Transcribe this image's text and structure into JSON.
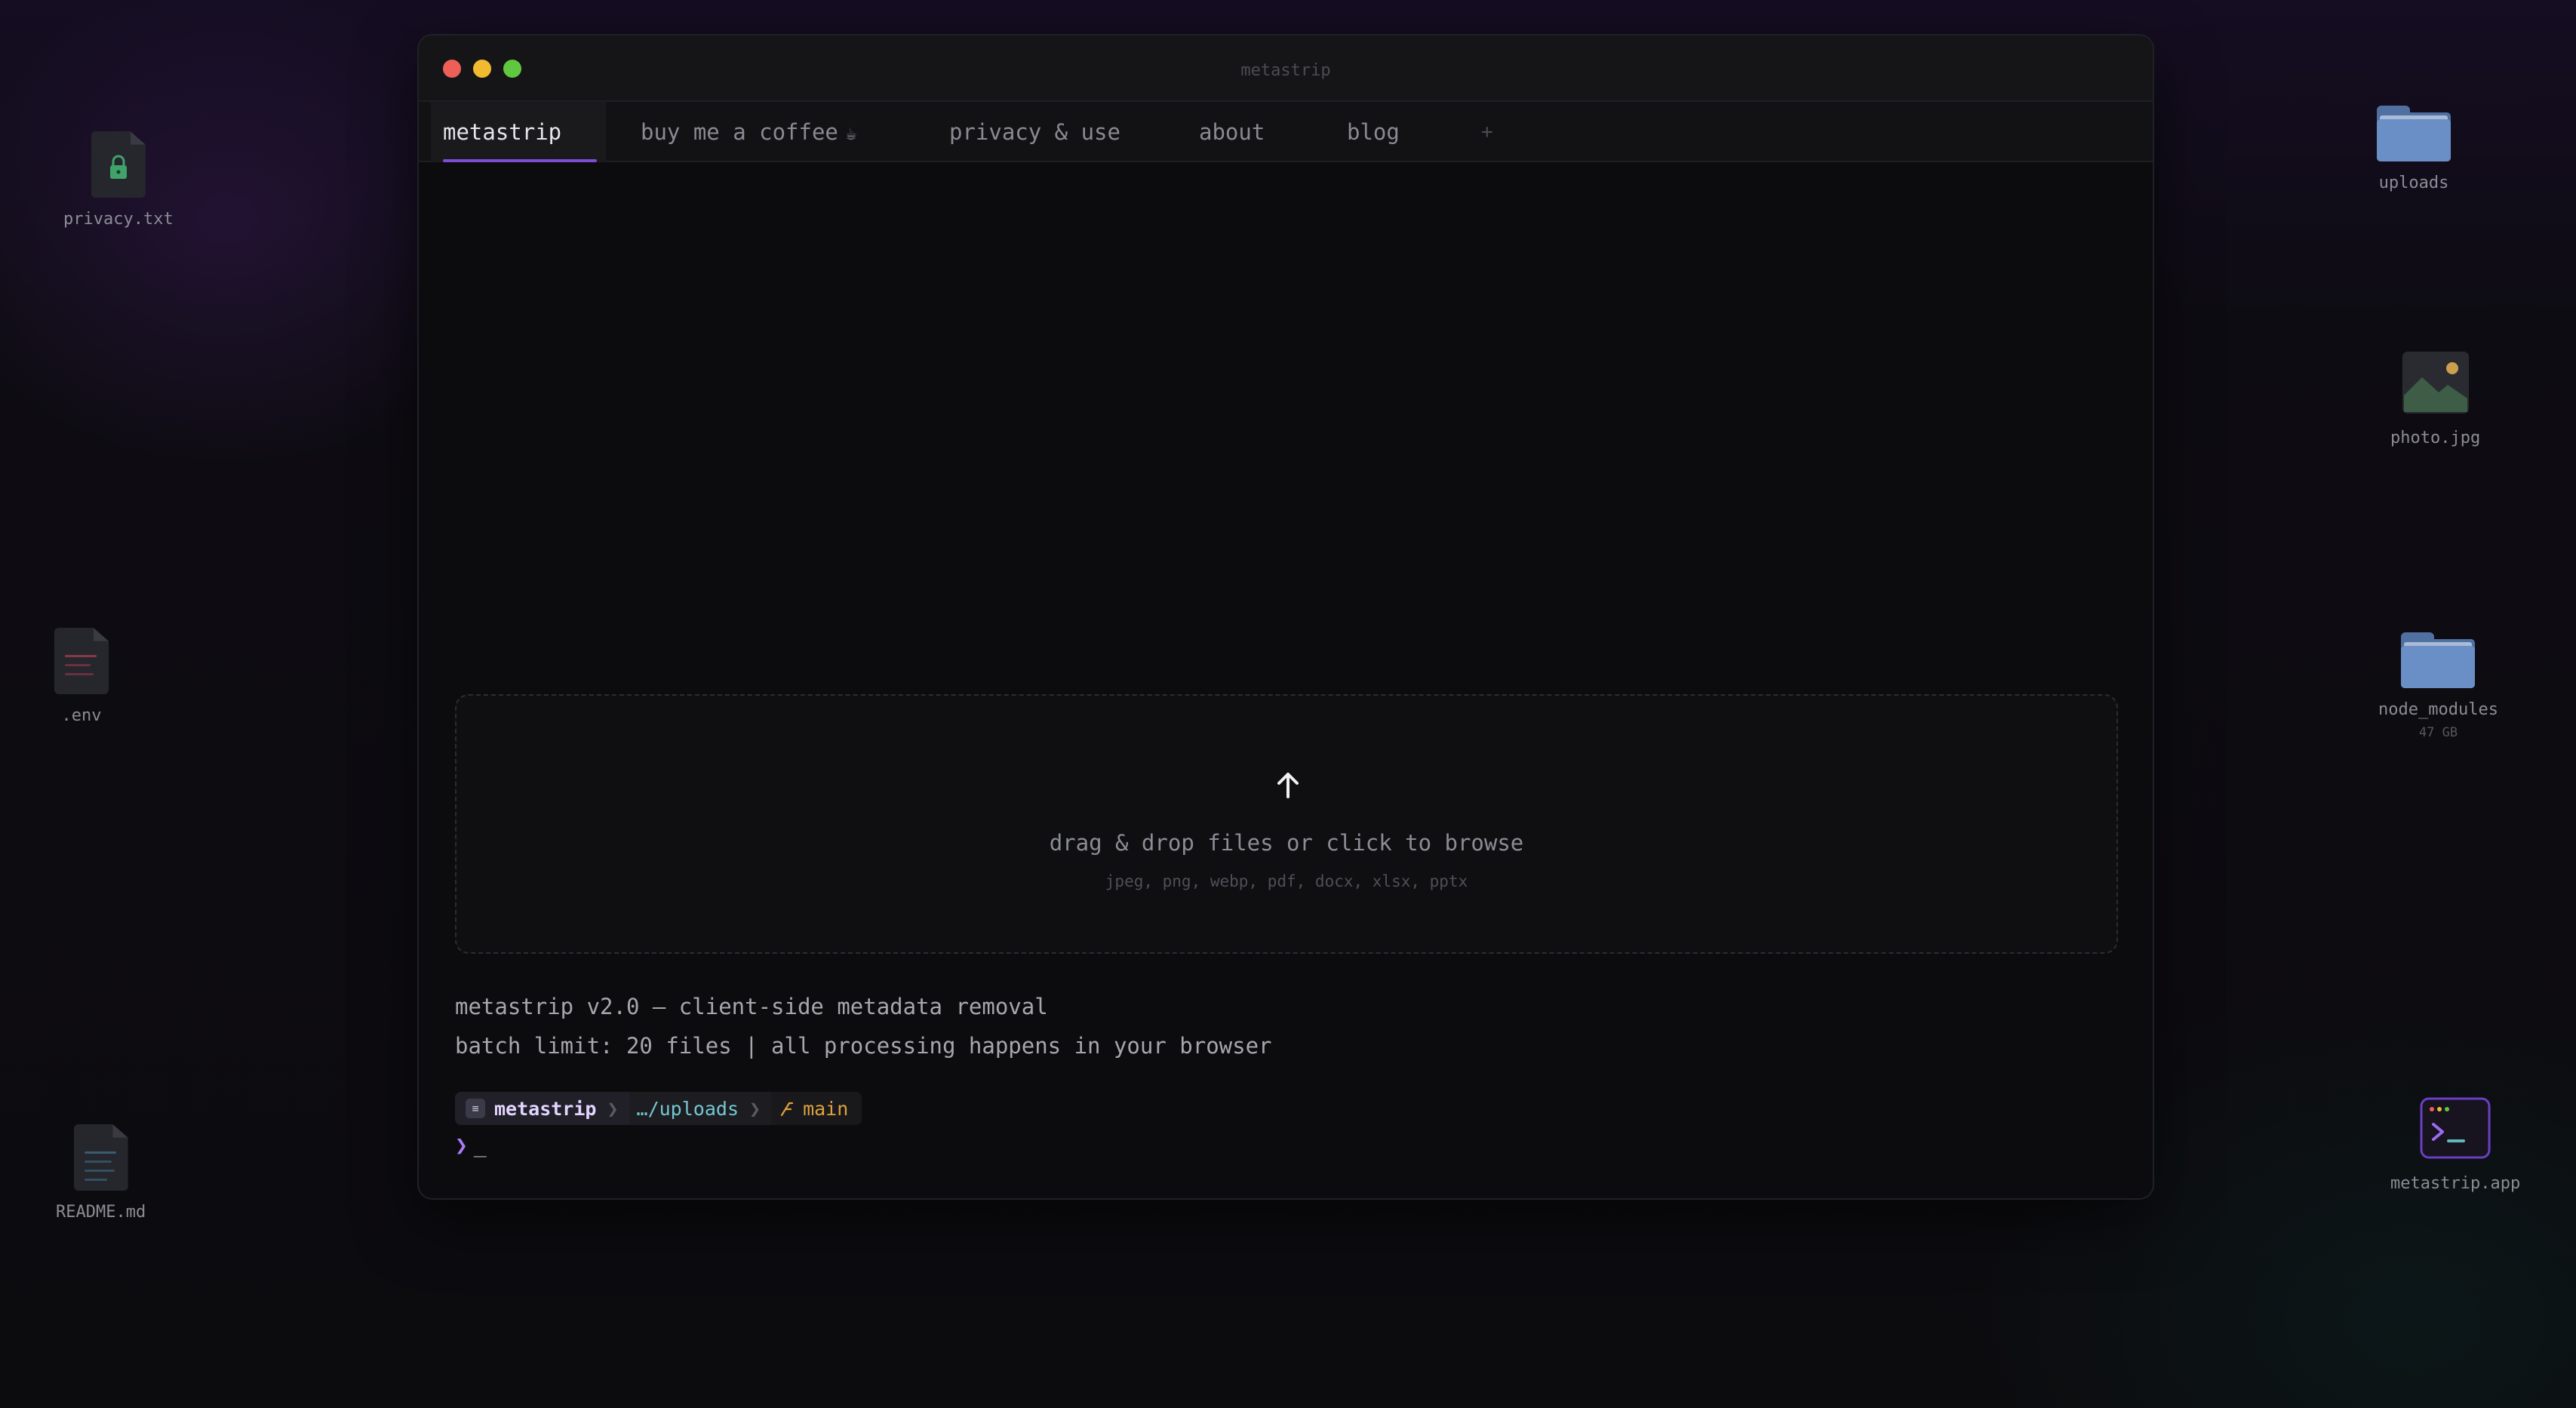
{
  "desktop": {
    "icons": [
      {
        "label": "privacy.txt",
        "icon": "locked-document-icon"
      },
      {
        "label": ".env",
        "icon": "env-file-icon"
      },
      {
        "label": "README.md",
        "icon": "markdown-document-icon"
      },
      {
        "label": "uploads",
        "icon": "folder-icon"
      },
      {
        "label": "photo.jpg",
        "icon": "image-file-icon"
      },
      {
        "label": "node_modules",
        "sublabel": "47 GB",
        "icon": "folder-icon"
      },
      {
        "label": "metastrip.app",
        "icon": "terminal-app-icon"
      }
    ]
  },
  "window": {
    "title": "metastrip",
    "controls": [
      "close",
      "minimize",
      "maximize"
    ],
    "tabs": [
      {
        "label": "metastrip",
        "active": true
      },
      {
        "label": "buy me a coffee",
        "icon": "coffee-cup-icon",
        "icon_glyph": "☕"
      },
      {
        "label": "privacy & use"
      },
      {
        "label": "about"
      },
      {
        "label": "blog"
      },
      {
        "label": "+"
      }
    ]
  },
  "dropzone": {
    "icon": "upload-arrow-icon",
    "main_text": "drag & drop files or click to browse",
    "formats": "jpeg, png, webp, pdf, docx, xlsx, pptx"
  },
  "info": {
    "line1": "metastrip v2.0 — client-side metadata removal",
    "line2": "batch limit: 20 files | all processing happens in your browser"
  },
  "prompt": {
    "name": "metastrip",
    "path": "…/uploads",
    "branch": "main",
    "separator": "❯",
    "chevron": "❯",
    "cursor": "_"
  },
  "colors": {
    "accent": "#7c4dd8",
    "path": "#74c7d4",
    "branch": "#e0a23c",
    "close": "#ee5f57",
    "minimize": "#f2bb2f",
    "maximize": "#5fc83f"
  }
}
